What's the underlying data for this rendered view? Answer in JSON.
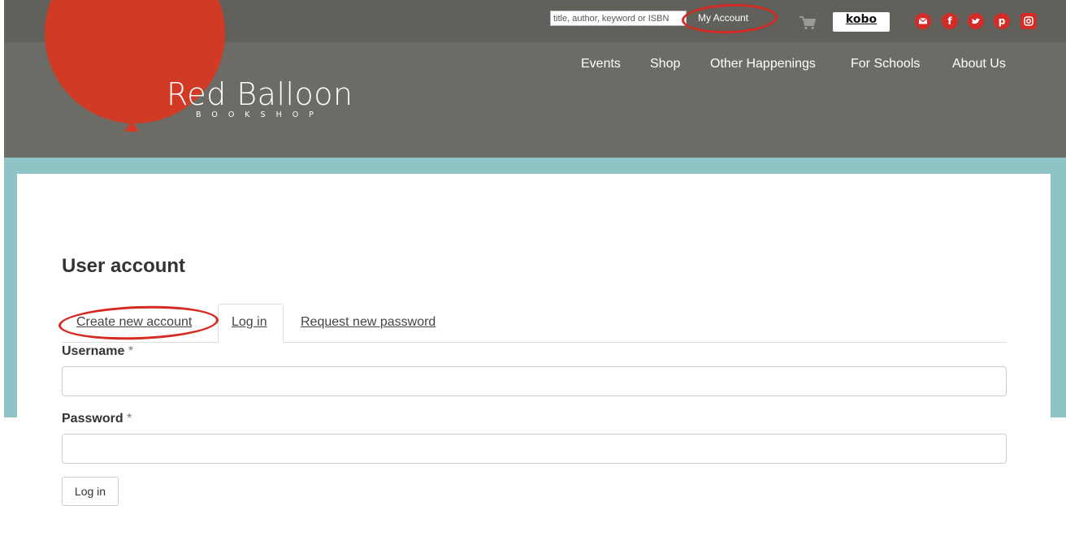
{
  "colors": {
    "header_bg": "#6c6b66",
    "header_top_bg": "#61605b",
    "balloon_red": "#d13a25",
    "teal_band": "#8fc3c6",
    "annotation_red": "#d42a22",
    "social_red": "#d32b26"
  },
  "logo": {
    "title": "Red Balloon",
    "subtitle": "BOOKSHOP"
  },
  "header": {
    "search_placeholder": "title, author, keyword or ISBN",
    "my_account_label": "My Account",
    "cart_icon": "shopping-cart-icon",
    "kobo_label": "kobo",
    "social_icons": [
      "email-icon",
      "facebook-icon",
      "twitter-icon",
      "pinterest-icon",
      "instagram-icon"
    ]
  },
  "nav": {
    "items": [
      "Events",
      "Shop",
      "Other Happenings",
      "For Schools",
      "About Us"
    ]
  },
  "main": {
    "title": "User account",
    "tabs": [
      {
        "label": "Create new account",
        "active": false
      },
      {
        "label": "Log in",
        "active": true
      },
      {
        "label": "Request new password",
        "active": false
      }
    ],
    "form": {
      "username_label": "Username",
      "password_label": "Password",
      "required_marker": "*",
      "username_value": "",
      "password_value": "",
      "submit_label": "Log in"
    }
  }
}
